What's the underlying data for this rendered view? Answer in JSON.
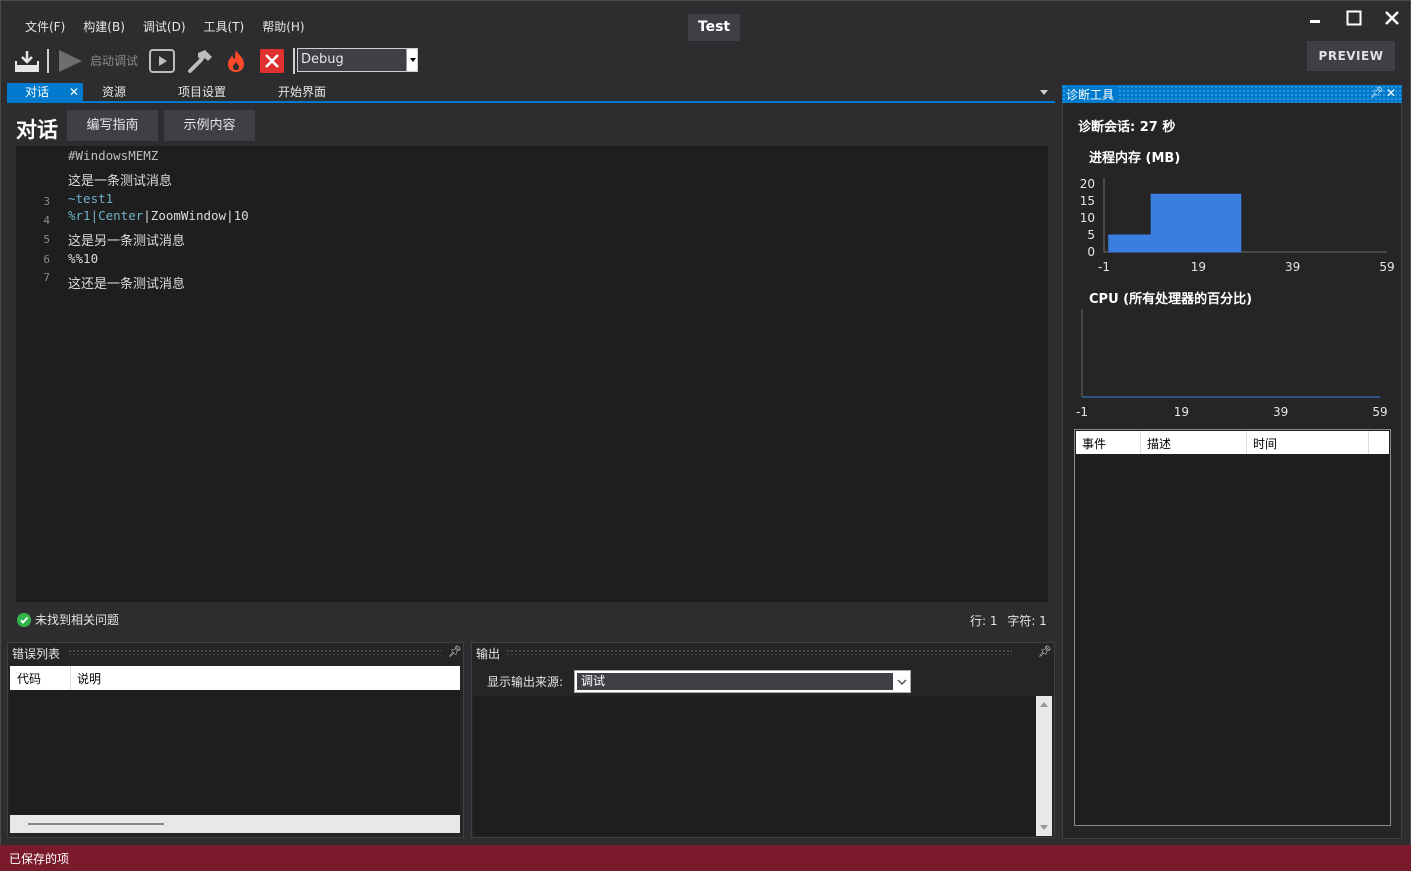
{
  "menu": [
    "文件(F)",
    "构建(B)",
    "调试(D)",
    "工具(T)",
    "帮助(H)"
  ],
  "app_title": "Test",
  "preview_label": "PREVIEW",
  "toolbar": {
    "start_debug_label": "启动调试",
    "config_value": "Debug"
  },
  "tabs": [
    {
      "label": "对话",
      "active": true
    },
    {
      "label": "资源",
      "active": false
    },
    {
      "label": "项目设置",
      "active": false
    },
    {
      "label": "开始界面",
      "active": false
    }
  ],
  "editor": {
    "title": "对话",
    "guide_button": "编写指南",
    "sample_button": "示例内容",
    "lines": [
      {
        "no": "",
        "text": "#WindowsMEMZ",
        "style": "mono"
      },
      {
        "no": "",
        "text": "这是一条测试消息",
        "style": "cjk"
      },
      {
        "no": "3",
        "text": "~test1",
        "style": "teal"
      },
      {
        "no": "4",
        "parts": [
          "%r1",
          "|",
          "Center",
          "|",
          "ZoomWindow",
          "|",
          "10"
        ],
        "style": "mono"
      },
      {
        "no": "5",
        "text": "这是另一条测试消息",
        "style": "cjk"
      },
      {
        "no": "6",
        "text": "%%10",
        "style": "mono"
      },
      {
        "no": "7",
        "text": "这还是一条测试消息",
        "style": "cjk"
      }
    ],
    "status": "未找到相关问题",
    "row_label": "行: 1",
    "char_label": "字符: 1"
  },
  "error_list": {
    "title": "错误列表",
    "columns": [
      "代码",
      "说明"
    ]
  },
  "output": {
    "title": "输出",
    "source_label": "显示输出来源:",
    "source_value": "调试"
  },
  "diagnostics": {
    "title": "诊断工具",
    "session": "诊断会话: 27 秒",
    "memory_title": "进程内存 (MB)",
    "cpu_title": "CPU (所有处理器的百分比)",
    "events_columns": [
      "事件",
      "描述",
      "时间"
    ]
  },
  "chart_data": [
    {
      "type": "area",
      "title": "进程内存 (MB)",
      "x_ticks": [
        "-1",
        "19",
        "39",
        "59"
      ],
      "y_ticks": [
        "20",
        "15",
        "10",
        "5",
        "0"
      ],
      "xlim": [
        -1,
        59
      ],
      "ylim": [
        0,
        20
      ],
      "series": [
        {
          "x": [
            0,
            9,
            9,
            28
          ],
          "values": [
            5,
            5,
            17,
            17
          ]
        }
      ],
      "color": "#3a7fe0"
    },
    {
      "type": "area",
      "title": "CPU (所有处理器的百分比)",
      "x_ticks": [
        "-1",
        "19",
        "39",
        "59"
      ],
      "xlim": [
        -1,
        59
      ],
      "series": [
        {
          "x": [
            -1,
            59
          ],
          "values": [
            0,
            0
          ]
        }
      ],
      "color": "#3a7fe0"
    }
  ],
  "status_bar": "已保存的项"
}
